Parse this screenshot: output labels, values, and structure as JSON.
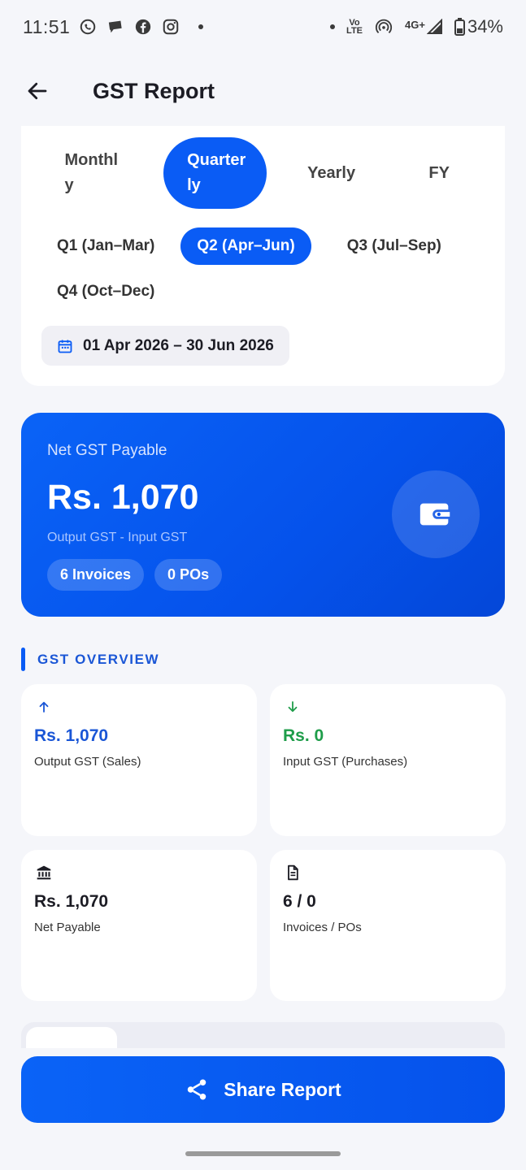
{
  "status_bar": {
    "time": "11:51",
    "network": "4G+",
    "volte_top": "Vo",
    "volte_bottom": "LTE",
    "battery": "34%"
  },
  "header": {
    "title": "GST Report"
  },
  "period": {
    "tabs": [
      {
        "label": "Monthly",
        "line1": "Monthl",
        "line2": "y",
        "active": false
      },
      {
        "label": "Quarterly",
        "line1": "Quarter",
        "line2": "ly",
        "active": true
      },
      {
        "label": "Yearly",
        "active": false
      },
      {
        "label": "FY",
        "active": false
      }
    ],
    "quarters": [
      {
        "label": "Q1 (Jan–Mar)",
        "active": false
      },
      {
        "label": "Q2 (Apr–Jun)",
        "active": true
      },
      {
        "label": "Q3 (Jul–Sep)",
        "active": false
      },
      {
        "label": "Q4 (Oct–Dec)",
        "active": false
      }
    ],
    "date_range": "01 Apr 2026 – 30 Jun 2026"
  },
  "summary": {
    "label": "Net GST Payable",
    "amount": "Rs. 1,070",
    "formula": "Output GST - Input GST",
    "invoices_chip": "6 Invoices",
    "pos_chip": "0 POs"
  },
  "overview": {
    "title": "GST OVERVIEW",
    "cards": [
      {
        "icon": "arrow-up-icon",
        "value": "Rs. 1,070",
        "label": "Output GST (Sales)",
        "color": "#1a56d6"
      },
      {
        "icon": "arrow-down-icon",
        "value": "Rs. 0",
        "label": "Input GST (Purchases)",
        "color": "#1f9d4a"
      },
      {
        "icon": "bank-icon",
        "value": "Rs. 1,070",
        "label": "Net Payable",
        "color": "#1c1c24"
      },
      {
        "icon": "document-icon",
        "value": "6 / 0",
        "label": "Invoices / POs",
        "color": "#1c1c24"
      }
    ]
  },
  "actions": {
    "share_label": "Share Report"
  },
  "colors": {
    "primary": "#0a5cf5",
    "success": "#1f9d4a",
    "background": "#f5f6fa"
  }
}
